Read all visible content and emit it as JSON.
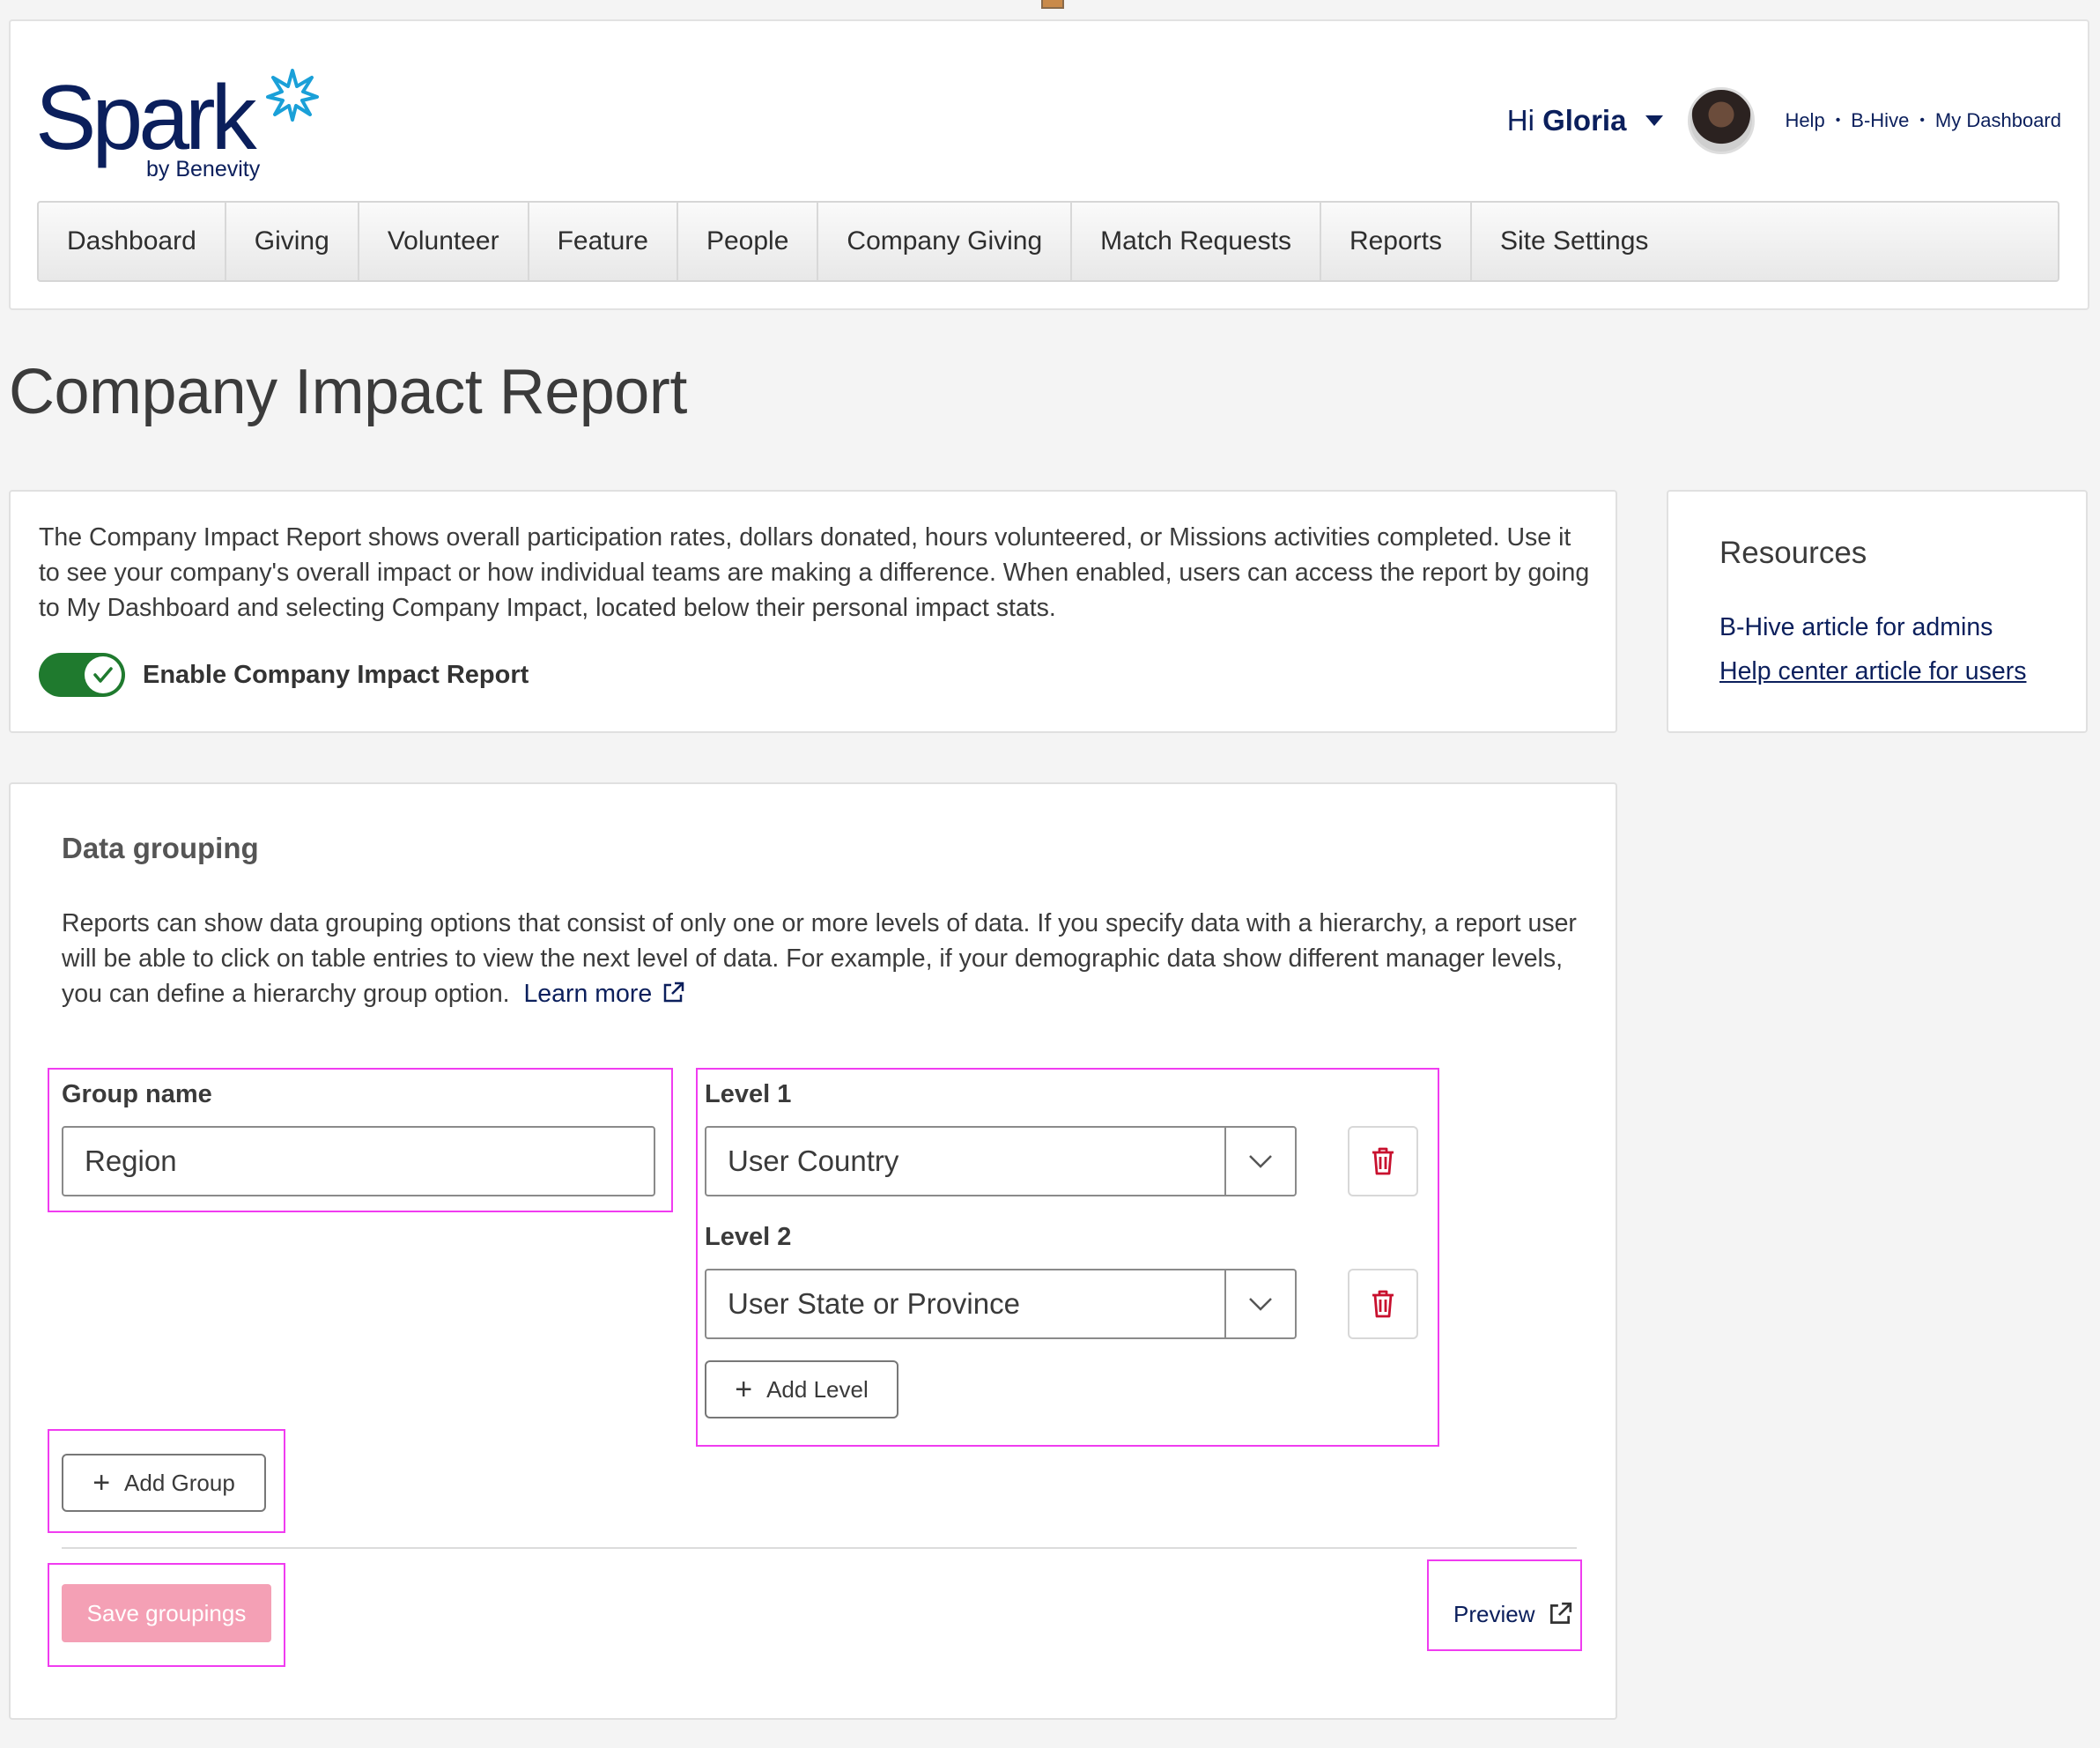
{
  "header": {
    "logo": {
      "wordmark": "Spark",
      "tagline": "by Benevity"
    },
    "greeting_prefix": "Hi",
    "user_name": "Gloria",
    "links": [
      "Help",
      "B-Hive",
      "My Dashboard"
    ],
    "link_separator": "•"
  },
  "nav": {
    "items": [
      "Dashboard",
      "Giving",
      "Volunteer",
      "Feature",
      "People",
      "Company Giving",
      "Match Requests",
      "Reports",
      "Site Settings"
    ]
  },
  "page": {
    "title": "Company Impact Report"
  },
  "intro": {
    "text": "The Company Impact Report shows overall participation rates, dollars donated, hours volunteered, or Missions activities completed. Use it to see your company's overall impact or how individual teams are making a difference. When enabled, users can access the report by going to My Dashboard and selecting Company Impact, located below their personal impact stats.",
    "toggle_label": "Enable Company Impact Report",
    "toggle_on": true
  },
  "resources": {
    "title": "Resources",
    "links": [
      "B-Hive article for admins",
      "Help center article for users"
    ]
  },
  "data_grouping": {
    "title": "Data grouping",
    "description": "Reports can show data grouping options that consist of only one or more levels of data. If you specify data with a hierarchy, a report user will be able to click on table entries to view the next level of data. For example, if your demographic data show different manager levels, you can define a hierarchy group option.",
    "learn_more": "Learn more",
    "group_name_label": "Group name",
    "group_name_value": "Region",
    "levels": [
      {
        "label": "Level 1",
        "value": "User Country"
      },
      {
        "label": "Level 2",
        "value": "User State or Province"
      }
    ],
    "add_level": "Add Level",
    "add_group": "Add Group",
    "save": "Save groupings",
    "preview": "Preview"
  },
  "colors": {
    "brand_navy": "#0b1f5c",
    "toggle_green": "#1f7a2e",
    "save_disabled_pink": "#f4a0b5",
    "trash_red": "#c8102e",
    "highlight_magenta": "#f03cf0"
  },
  "icons": [
    "star-burst-icon",
    "caret-down-icon",
    "check-icon",
    "external-link-icon",
    "chevron-down-icon",
    "trash-icon",
    "plus-icon"
  ]
}
